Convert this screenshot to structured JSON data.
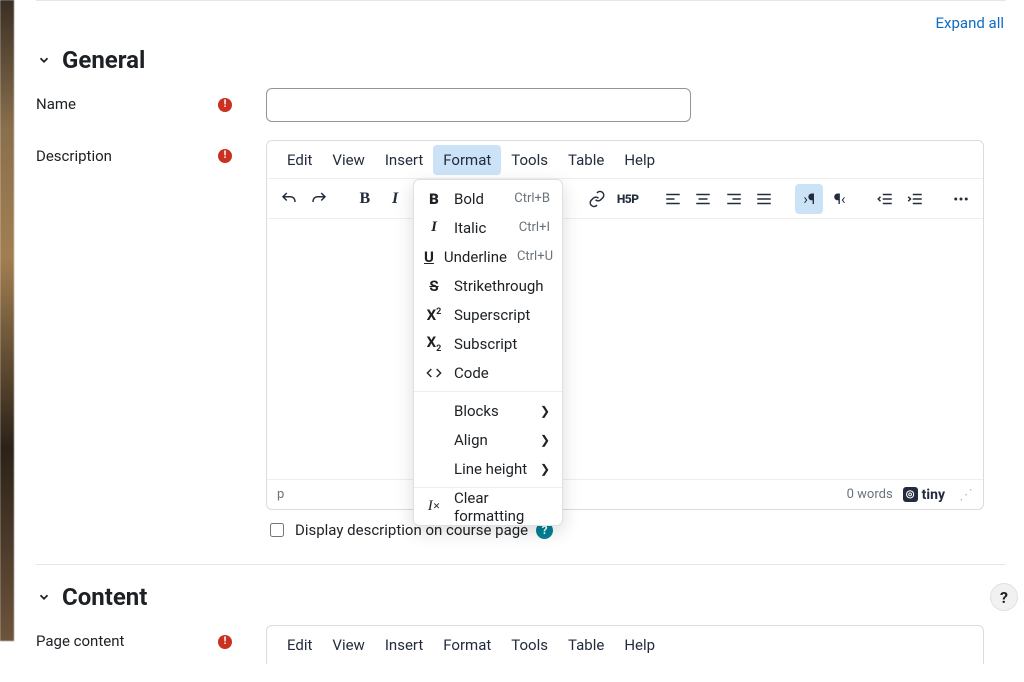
{
  "top": {
    "expand_all": "Expand all"
  },
  "sections": {
    "general": {
      "title": "General",
      "name_label": "Name",
      "description_label": "Description",
      "display_checkbox_label": "Display description on course page"
    },
    "content": {
      "title": "Content",
      "page_content_label": "Page content"
    }
  },
  "editor": {
    "menubar": [
      "Edit",
      "View",
      "Insert",
      "Format",
      "Tools",
      "Table",
      "Help"
    ],
    "active_menu_index": 3,
    "status_path": "p",
    "word_count": "0 words",
    "brand": "tiny"
  },
  "format_menu": {
    "items": [
      {
        "id": "bold",
        "label": "Bold",
        "shortcut": "Ctrl+B"
      },
      {
        "id": "italic",
        "label": "Italic",
        "shortcut": "Ctrl+I"
      },
      {
        "id": "underline",
        "label": "Underline",
        "shortcut": "Ctrl+U"
      },
      {
        "id": "strike",
        "label": "Strikethrough"
      },
      {
        "id": "superscript",
        "label": "Superscript"
      },
      {
        "id": "subscript",
        "label": "Subscript"
      },
      {
        "id": "code",
        "label": "Code"
      }
    ],
    "submenus": [
      {
        "id": "blocks",
        "label": "Blocks"
      },
      {
        "id": "align",
        "label": "Align"
      },
      {
        "id": "lineheight",
        "label": "Line height"
      }
    ],
    "clear": {
      "label": "Clear formatting"
    }
  },
  "icons": {
    "undo": "undo-icon",
    "redo": "redo-icon",
    "bold": "bold-icon",
    "italic": "italic-icon",
    "link": "link-icon",
    "h5p": "h5p-icon",
    "align_left": "align-left-icon",
    "align_center": "align-center-icon",
    "align_right": "align-right-icon",
    "align_justify": "align-justify-icon",
    "ltr": "ltr-icon",
    "rtl": "rtl-icon",
    "outdent": "outdent-icon",
    "indent": "indent-icon",
    "more": "more-icon"
  }
}
